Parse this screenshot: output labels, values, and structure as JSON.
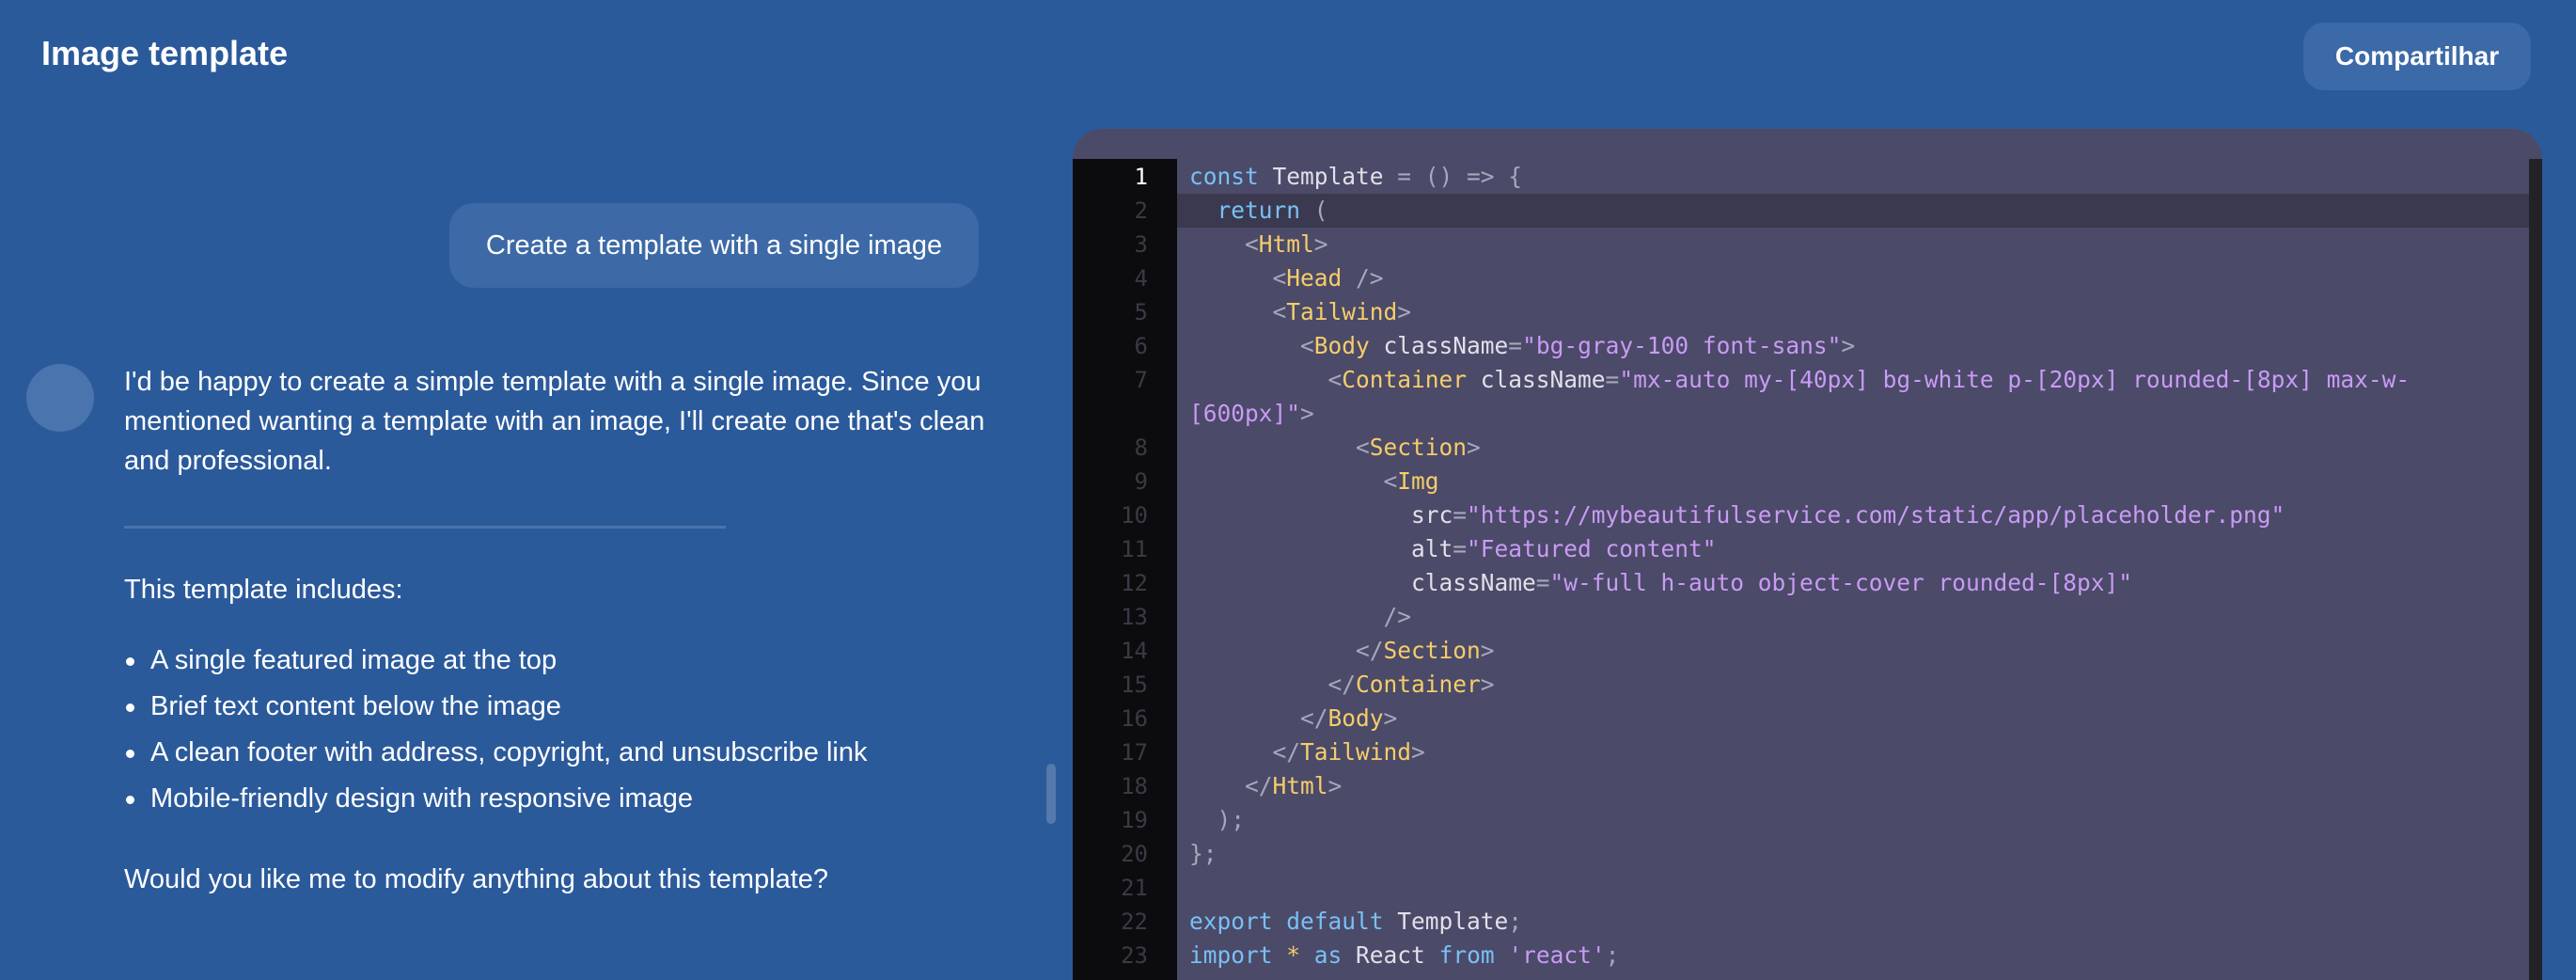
{
  "header": {
    "title": "Image template",
    "share_label": "Compartilhar"
  },
  "chat": {
    "user_message": "Create a template with a single image",
    "assistant_intro": "I'd be happy to create a simple template with a single image. Since you mentioned wanting a template with an image, I'll create one that's clean and professional.",
    "includes_heading": "This template includes:",
    "features": [
      "A single featured image at the top",
      "Brief text content below the image",
      "A clean footer with address, copyright, and unsubscribe link",
      "Mobile-friendly design with responsive image"
    ],
    "closing": "Would you like me to modify anything about this template?"
  },
  "editor": {
    "active_line": 1,
    "colors": {
      "keyword": "#79c0f5",
      "tag": "#f5cd6a",
      "string": "#c99bf5",
      "punctuation": "#a7a7bc",
      "text": "#e0e0ea"
    },
    "lines": [
      {
        "n": "1",
        "t": [
          [
            "kw",
            "const"
          ],
          [
            "id",
            " Template "
          ],
          [
            "punct",
            "= () => {"
          ]
        ]
      },
      {
        "n": "2",
        "t": [
          [
            "kw",
            "  return"
          ],
          [
            "punct",
            " ("
          ]
        ]
      },
      {
        "n": "3",
        "t": [
          [
            "punct",
            "    <"
          ],
          [
            "tag",
            "Html"
          ],
          [
            "punct",
            ">"
          ]
        ]
      },
      {
        "n": "4",
        "t": [
          [
            "punct",
            "      <"
          ],
          [
            "tag",
            "Head"
          ],
          [
            "punct",
            " />"
          ]
        ]
      },
      {
        "n": "5",
        "t": [
          [
            "punct",
            "      <"
          ],
          [
            "tag",
            "Tailwind"
          ],
          [
            "punct",
            ">"
          ]
        ]
      },
      {
        "n": "6",
        "t": [
          [
            "punct",
            "        <"
          ],
          [
            "tag",
            "Body"
          ],
          [
            "attr",
            " className"
          ],
          [
            "punct",
            "="
          ],
          [
            "str",
            "\"bg-gray-100 font-sans\""
          ],
          [
            "punct",
            ">"
          ]
        ]
      },
      {
        "n": "7",
        "t": [
          [
            "punct",
            "          <"
          ],
          [
            "tag",
            "Container"
          ],
          [
            "attr",
            " className"
          ],
          [
            "punct",
            "="
          ],
          [
            "str",
            "\"mx-auto my-[40px] bg-white p-[20px] rounded-[8px] max-w-"
          ]
        ]
      },
      {
        "n": "",
        "t": [
          [
            "str",
            "[600px]\""
          ],
          [
            "punct",
            ">"
          ]
        ]
      },
      {
        "n": "8",
        "t": [
          [
            "punct",
            "            <"
          ],
          [
            "tag",
            "Section"
          ],
          [
            "punct",
            ">"
          ]
        ]
      },
      {
        "n": "9",
        "t": [
          [
            "punct",
            "              <"
          ],
          [
            "tag",
            "Img"
          ]
        ]
      },
      {
        "n": "10",
        "t": [
          [
            "attr",
            "                src"
          ],
          [
            "punct",
            "="
          ],
          [
            "str",
            "\"https://mybeautifulservice.com/static/app/placeholder.png\""
          ]
        ]
      },
      {
        "n": "11",
        "t": [
          [
            "attr",
            "                alt"
          ],
          [
            "punct",
            "="
          ],
          [
            "str",
            "\"Featured content\""
          ]
        ]
      },
      {
        "n": "12",
        "t": [
          [
            "attr",
            "                className"
          ],
          [
            "punct",
            "="
          ],
          [
            "str",
            "\"w-full h-auto object-cover rounded-[8px]\""
          ]
        ]
      },
      {
        "n": "13",
        "t": [
          [
            "punct",
            "              />"
          ]
        ]
      },
      {
        "n": "14",
        "t": [
          [
            "punct",
            "            </"
          ],
          [
            "tag",
            "Section"
          ],
          [
            "punct",
            ">"
          ]
        ]
      },
      {
        "n": "15",
        "t": [
          [
            "punct",
            "          </"
          ],
          [
            "tag",
            "Container"
          ],
          [
            "punct",
            ">"
          ]
        ]
      },
      {
        "n": "16",
        "t": [
          [
            "punct",
            "        </"
          ],
          [
            "tag",
            "Body"
          ],
          [
            "punct",
            ">"
          ]
        ]
      },
      {
        "n": "17",
        "t": [
          [
            "punct",
            "      </"
          ],
          [
            "tag",
            "Tailwind"
          ],
          [
            "punct",
            ">"
          ]
        ]
      },
      {
        "n": "18",
        "t": [
          [
            "punct",
            "    </"
          ],
          [
            "tag",
            "Html"
          ],
          [
            "punct",
            ">"
          ]
        ]
      },
      {
        "n": "19",
        "t": [
          [
            "punct",
            "  );"
          ]
        ]
      },
      {
        "n": "20",
        "t": [
          [
            "punct",
            "};"
          ]
        ]
      },
      {
        "n": "21",
        "t": []
      },
      {
        "n": "22",
        "t": [
          [
            "kw",
            "export"
          ],
          [
            "kw",
            " default"
          ],
          [
            "id",
            " Template"
          ],
          [
            "punct",
            ";"
          ]
        ]
      },
      {
        "n": "23",
        "t": [
          [
            "kw",
            "import"
          ],
          [
            "tag",
            " *"
          ],
          [
            "kw",
            " as"
          ],
          [
            "id",
            " React"
          ],
          [
            "kw",
            " from"
          ],
          [
            "str",
            " 'react'"
          ],
          [
            "punct",
            ";"
          ]
        ]
      }
    ]
  }
}
